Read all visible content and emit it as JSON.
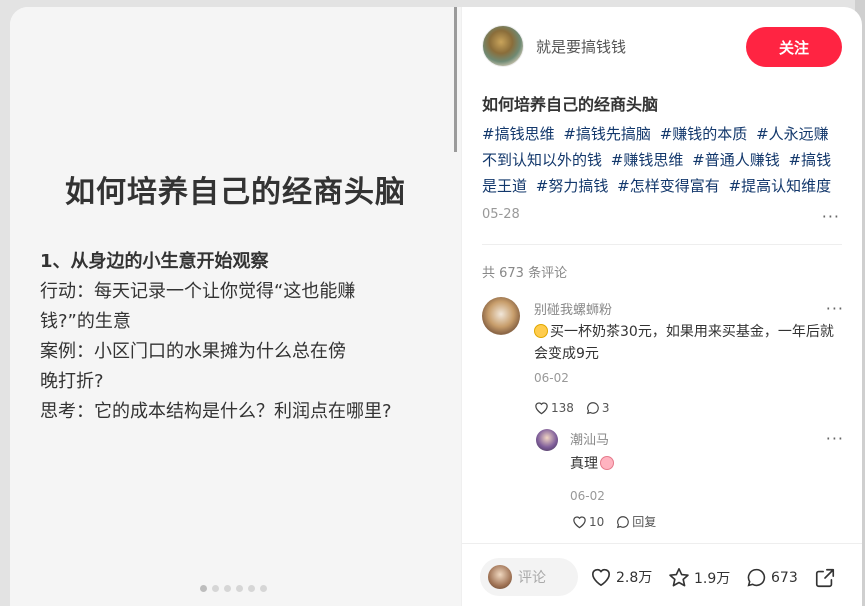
{
  "slide": {
    "title": "如何培养自己的经商头脑",
    "heading": "1、从身边的小生意开始观察",
    "lines": [
      "行动：每天记录一个让你觉得“这也能赚",
      "钱?”的生意",
      "案例：小区门口的水果摊为什么总在傍",
      "晚打折?",
      "思考：它的成本结构是什么？利润点在哪里?"
    ]
  },
  "author": {
    "name": "就是要搞钱钱",
    "follow_label": "关注"
  },
  "post": {
    "title": "如何培养自己的经商头脑",
    "tags": [
      "#搞钱思维",
      "#搞钱先搞脑",
      "#赚钱的本质",
      "#人永远赚不到认知以外的钱",
      "#赚钱思维",
      "#普通人赚钱",
      "#搞钱是王道",
      "#努力搞钱",
      "#怎样变得富有",
      "#提高认知维度"
    ],
    "date": "05-28",
    "more": "···"
  },
  "comments_count": "共 673 条评论",
  "comments": [
    {
      "user": "别碰我螺蛳粉",
      "text": "买一杯奶茶30元，如果用来买基金，一年后就会变成9元",
      "date": "06-02",
      "likes": "138",
      "replies": "3"
    },
    {
      "user": "潮汕马",
      "text": "真理",
      "date": "06-02",
      "likes": "10",
      "reply_label": "回复"
    }
  ],
  "bottom": {
    "comment_placeholder": "评论",
    "likes": "2.8万",
    "collects": "1.9万",
    "comments": "673"
  },
  "colors": {
    "accent": "#ff2442",
    "tag": "#13386c"
  }
}
